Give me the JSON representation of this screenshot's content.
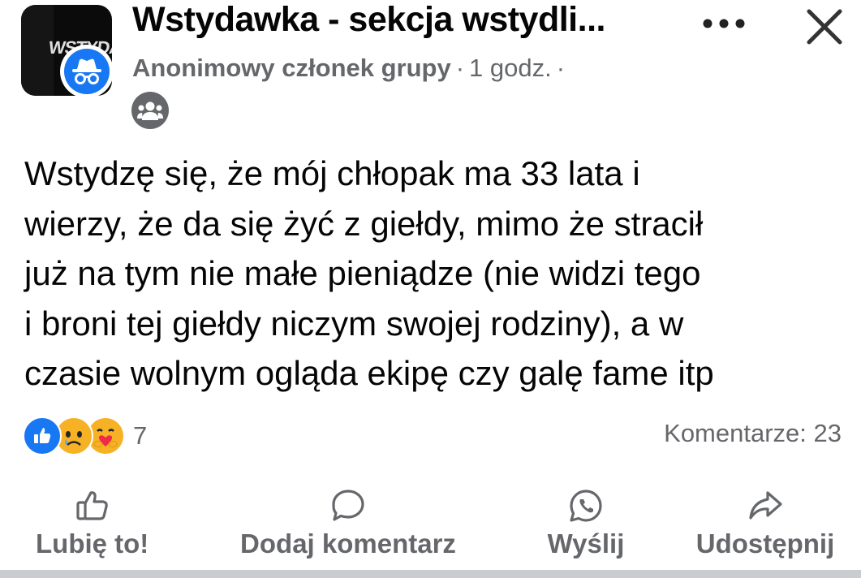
{
  "header": {
    "group_name": "Wstydawka - sekcja wstydli...",
    "group_logo_text": "WSTYDAI",
    "author": "Anonimowy członek grupy",
    "time": "1 godz.",
    "separator": "·",
    "more_icon": "more-horizontal-icon",
    "close_icon": "close-icon",
    "audience_icon": "group-audience-icon"
  },
  "post": {
    "lines": [
      "Wstydzę się, że mój chłopak ma 33 lata i",
      "wierzy, że da się żyć z giełdy, mimo że stracił",
      "już na tym nie małe pieniądze (nie widzi tego",
      "i broni tej giełdy niczym swojej rodziny), a w",
      "czasie wolnym ogląda ekipę czy galę fame itp"
    ]
  },
  "stats": {
    "reaction_icons": [
      "like-icon",
      "sad-icon",
      "care-icon"
    ],
    "reaction_count": "7",
    "comments": "Komentarze: 23"
  },
  "actions": [
    {
      "icon": "thumbs-up-icon",
      "label": "Lubię to!"
    },
    {
      "icon": "comment-icon",
      "label": "Dodaj komentarz"
    },
    {
      "icon": "whatsapp-icon",
      "label": "Wyślij"
    },
    {
      "icon": "share-icon",
      "label": "Udostępnij"
    }
  ],
  "colors": {
    "text": "#050505",
    "muted": "#65676b",
    "brand_blue": "#1877f2"
  }
}
